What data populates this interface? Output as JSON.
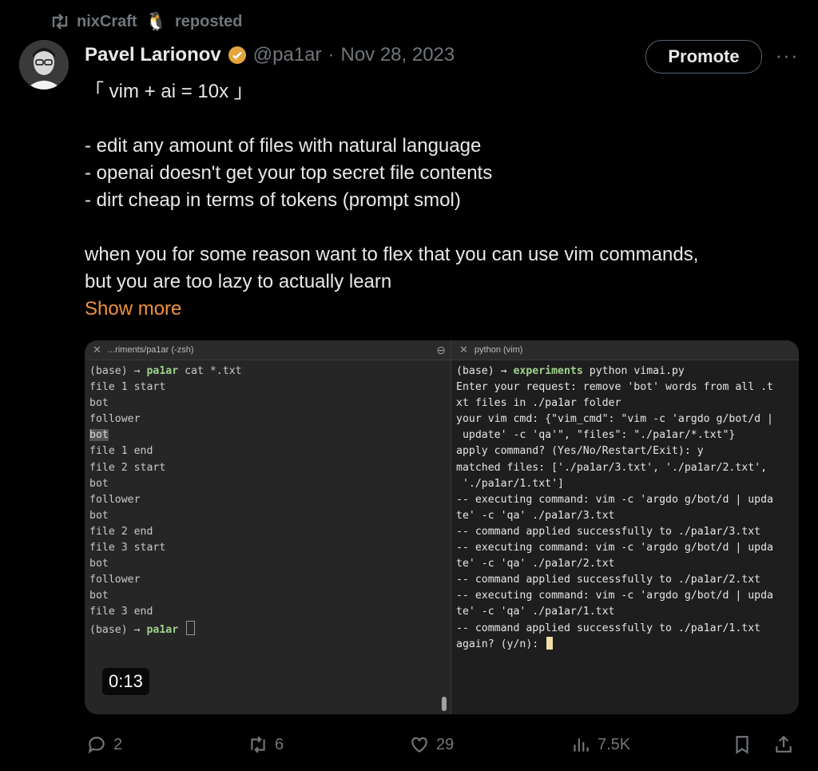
{
  "repost": {
    "user": "nixCraft",
    "emoji": "🐧",
    "label": "reposted"
  },
  "author": {
    "name": "Pavel Larionov",
    "handle": "@pa1ar",
    "separator": "·",
    "date": "Nov 28, 2023"
  },
  "promote_label": "Promote",
  "more_label": "···",
  "text": {
    "line1": "「 vim + ai = 10x 」",
    "line2": "- edit any amount of files with natural language",
    "line3": "- openai doesn't get your top secret file contents",
    "line4": "- dirt cheap in terms of tokens (prompt smol)",
    "line5": "when you for some reason want to flex that you can use vim commands,",
    "line6": "but you are too lazy to actually learn",
    "show_more": "Show more"
  },
  "video": {
    "duration": "0:13",
    "left_title": "...riments/pa1ar (-zsh)",
    "right_title": "python (vim)",
    "left_prompt_env": "(base) → ",
    "left_prompt_dir": "pa1ar",
    "left_cmd": " cat *.txt",
    "left_lines": [
      "file 1 start",
      "bot",
      "follower",
      "bot",
      "file 1 end",
      "file 2 start",
      "bot",
      "follower",
      "bot",
      "file 2 end",
      "file 3 start",
      "bot",
      "follower",
      "bot",
      "file 3 end"
    ],
    "left_end_env": "(base) → ",
    "left_end_dir": "pa1ar",
    "right_prompt_env": "(base) → ",
    "right_prompt_dir": "experiments",
    "right_cmd": " python vimai.py",
    "right_lines": [
      "Enter your request: remove 'bot' words from all .t",
      "xt files in ./pa1ar folder",
      "your vim cmd: {\"vim_cmd\": \"vim -c 'argdo g/bot/d |",
      " update' -c 'qa'\", \"files\": \"./pa1ar/*.txt\"}",
      "apply command? (Yes/No/Restart/Exit): y",
      "matched files: ['./pa1ar/3.txt', './pa1ar/2.txt',",
      " './pa1ar/1.txt']",
      "-- executing command: vim -c 'argdo g/bot/d | upda",
      "te' -c 'qa' ./pa1ar/3.txt",
      "-- command applied successfully to ./pa1ar/3.txt",
      "-- executing command: vim -c 'argdo g/bot/d | upda",
      "te' -c 'qa' ./pa1ar/2.txt",
      "-- command applied successfully to ./pa1ar/2.txt",
      "-- executing command: vim -c 'argdo g/bot/d | upda",
      "te' -c 'qa' ./pa1ar/1.txt",
      "-- command applied successfully to ./pa1ar/1.txt"
    ],
    "right_last": "again? (y/n): "
  },
  "actions": {
    "replies": "2",
    "reposts": "6",
    "likes": "29",
    "views": "7.5K"
  },
  "colors": {
    "accent": "#f0913a",
    "verified": "#e2a43b",
    "muted": "#71767b"
  }
}
